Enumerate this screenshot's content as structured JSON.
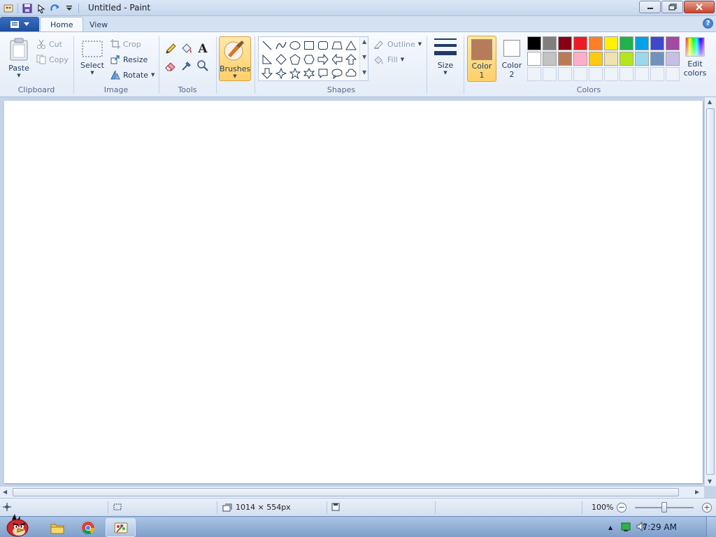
{
  "window": {
    "title": "Untitled - Paint"
  },
  "quick_access": {
    "items": [
      "save-icon",
      "undo-icon",
      "redo-icon",
      "customize-dropdown-icon"
    ]
  },
  "tabs": [
    {
      "label": "Home",
      "active": true
    },
    {
      "label": "View",
      "active": false
    }
  ],
  "help": {
    "label": "?"
  },
  "clipboard": {
    "paste_label": "Paste",
    "cut_label": "Cut",
    "copy_label": "Copy",
    "group_label": "Clipboard"
  },
  "image": {
    "select_label": "Select",
    "crop_label": "Crop",
    "resize_label": "Resize",
    "rotate_label": "Rotate",
    "group_label": "Image"
  },
  "tools": {
    "items": [
      "pencil-icon",
      "fill-bucket-icon",
      "text-icon",
      "eraser-icon",
      "color-picker-icon",
      "magnifier-icon"
    ],
    "text_glyph": "A",
    "group_label": "Tools"
  },
  "brushes": {
    "label": "Brushes"
  },
  "shapes": {
    "outline_label": "Outline",
    "fill_label": "Fill",
    "group_label": "Shapes"
  },
  "size": {
    "label": "Size"
  },
  "colors": {
    "color1_label_line1": "Color",
    "color1_label_line2": "1",
    "color1_value": "#b57c5c",
    "color2_label_line1": "Color",
    "color2_label_line2": "2",
    "color2_value": "#ffffff",
    "edit_label_line1": "Edit",
    "edit_label_line2": "colors",
    "group_label": "Colors",
    "palette_row1": [
      "#000000",
      "#7f7f7f",
      "#880015",
      "#ed1c24",
      "#ff7f27",
      "#fff200",
      "#22b14c",
      "#00a2e8",
      "#3f48cc",
      "#a349a4"
    ],
    "palette_row2": [
      "#ffffff",
      "#c3c3c3",
      "#b97a57",
      "#ffaec9",
      "#ffc90e",
      "#efe4b0",
      "#b5e61d",
      "#99d9ea",
      "#7092be",
      "#c8bfe7"
    ]
  },
  "status": {
    "canvas_size": "1014 × 554px",
    "zoom": "100%"
  },
  "taskbar": {
    "apps": [
      "angry-birds-start-icon",
      "explorer-icon",
      "chrome-icon",
      "paint-icon"
    ],
    "clock": "7:29 AM"
  }
}
